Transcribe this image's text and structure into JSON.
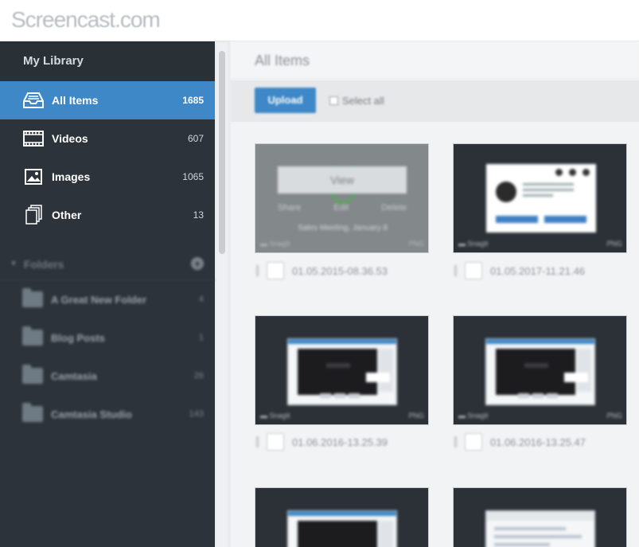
{
  "app": {
    "logo_text": "Screencast.com"
  },
  "sidebar": {
    "title": "My Library",
    "nav": [
      {
        "label": "All Items",
        "count": "1685",
        "icon": "inbox-tray-icon",
        "active": true
      },
      {
        "label": "Videos",
        "count": "607",
        "icon": "film-strip-icon",
        "active": false
      },
      {
        "label": "Images",
        "count": "1065",
        "icon": "image-icon",
        "active": false
      },
      {
        "label": "Other",
        "count": "13",
        "icon": "stacked-pages-icon",
        "active": false
      }
    ],
    "folders_label": "Folders",
    "folders": [
      {
        "label": "A Great New Folder",
        "count": "4"
      },
      {
        "label": "Blog Posts",
        "count": "1"
      },
      {
        "label": "Camtasia",
        "count": "26"
      },
      {
        "label": "Camtasia Studio",
        "count": "143"
      }
    ]
  },
  "main": {
    "title": "All Items",
    "upload_label": "Upload",
    "select_all_label": "Select all",
    "items": [
      {
        "name": "01.05.2015-08.36.53",
        "hover_view": "View",
        "hover_actions": [
          "Share",
          "Edit",
          "Delete"
        ],
        "hover_title": "Sales Meeting, January 8",
        "folder_tag": "SnagIt",
        "kind": "PNG"
      },
      {
        "name": "01.05.2017-11.21.46",
        "folder_tag": "SnagIt",
        "kind": "PNG"
      },
      {
        "name": "01.06.2016-13.25.39",
        "folder_tag": "SnagIt",
        "kind": "PNG"
      },
      {
        "name": "01.06.2016-13.25.47",
        "folder_tag": "SnagIt",
        "kind": "PNG"
      }
    ]
  }
}
